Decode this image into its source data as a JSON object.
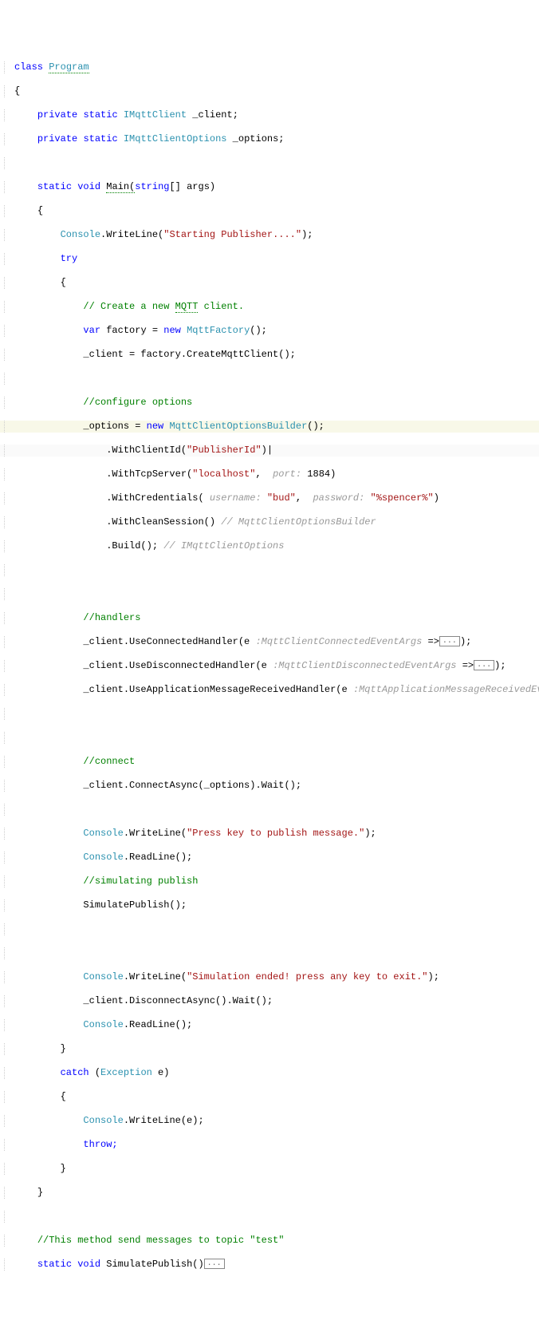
{
  "code": {
    "class_kw": "class",
    "class_name": "Program",
    "lbrace": "{",
    "rbrace": "}",
    "private_kw": "private",
    "static_kw": "static",
    "void_kw": "void",
    "var_kw": "var",
    "new_kw": "new",
    "try_kw": "try",
    "catch_kw": "catch",
    "throw_kw": "throw;",
    "string_arr": "string",
    "IMqttClient": "IMqttClient",
    "IMqttClientOptions": "IMqttClientOptions",
    "Exception": "Exception",
    "MqttFactory": "MqttFactory",
    "MqttClientOptionsBuilder": "MqttClientOptionsBuilder",
    "Console": "Console",
    "field_client": " _client;",
    "field_options": " _options;",
    "main_sig": "Main(",
    "args_param": "[] args)",
    "writeline": ".WriteLine(",
    "readline": ".ReadLine();",
    "str_starting": "\"Starting Publisher....\"",
    "str_press": "\"Press key to publish message.\"",
    "str_simend": "\"Simulation ended! press any key to exit.\"",
    "str_publisherid": "\"PublisherId\"",
    "str_localhost": "\"localhost\"",
    "str_bud": "\"bud\"",
    "str_spencer": "\"%spencer%\"",
    "com_create": "// Create a new ",
    "com_mqtt": "MQTT",
    "com_client": " client.",
    "com_config": "//configure options",
    "com_handlers": "//handlers",
    "com_connect": "//connect",
    "com_sim": "//simulating publish",
    "com_method": "//This method send messages to topic \"test\"",
    "factory_assign": " factory = ",
    "factory_ctor": "();",
    "client_assign": "_client = factory.CreateMqttClient();",
    "options_assign": "_options = ",
    "withclientid": ".WithClientId(",
    "withtcp": ".WithTcpServer(",
    "withcred": ".WithCredentials(",
    "withclean": ".WithCleanSession() ",
    "build_call": ".Build(); ",
    "hint_port": "port:",
    "port_val": " 1884)",
    "hint_user": " username:",
    "hint_pass": "password:",
    "closeparen": ")",
    "closeparen_pipe": ")|",
    "comma": ", ",
    "comma2": ",  ",
    "hint_builder": "// MqttClientOptionsBuilder",
    "hint_ioptions": "// IMqttClientOptions",
    "h_connected": "_client.UseConnectedHandler(e ",
    "h_connected_t": ":MqttClientConnectedEventArgs",
    "h_disconnected": "_client.UseDisconnectedHandler(e ",
    "h_disconnected_t": ":MqttClientDisconnectedEventArgs",
    "h_appmsg": "_client.UseApplicationMessageReceivedHandler(e ",
    "h_appmsg_t": ":MqttApplicationMessageReceivedEventArgs",
    "arrow": " =>",
    "fold": "...",
    "handler_end": ");",
    "connect_call": "_client.ConnectAsync(_options).Wait();",
    "simpub": "SimulatePublish();",
    "disconnect": "_client.DisconnectAsync().Wait();",
    "catch_sig": " (",
    "catch_e": " e)",
    "write_e": ".WriteLine(e);",
    "simpub_sig": "SimulatePublish()",
    "closep_semi": ");"
  }
}
